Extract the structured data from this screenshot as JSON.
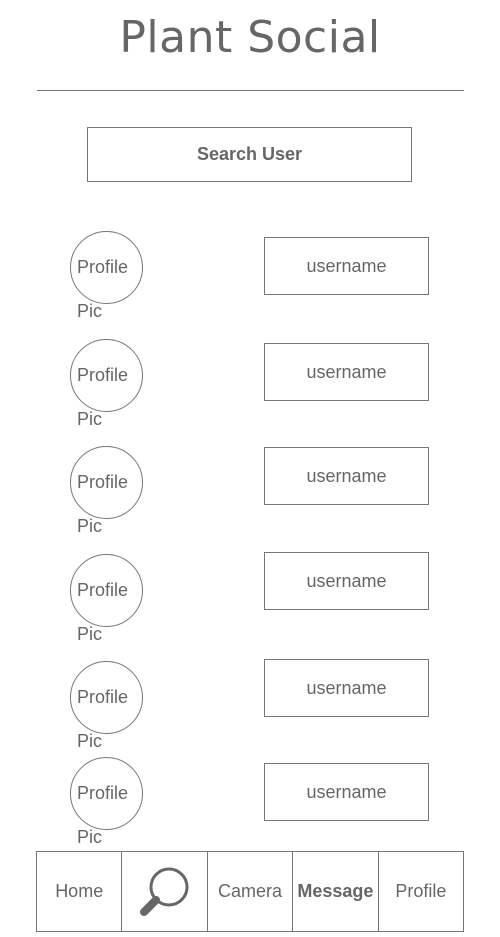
{
  "header": {
    "title": "Plant Social"
  },
  "search": {
    "label": "Search User"
  },
  "users": [
    {
      "pic_line1": "Profile",
      "pic_line2": "Pic",
      "username": "username"
    },
    {
      "pic_line1": "Profile",
      "pic_line2": "Pic",
      "username": "username"
    },
    {
      "pic_line1": "Profile",
      "pic_line2": "Pic",
      "username": "username"
    },
    {
      "pic_line1": "Profile",
      "pic_line2": "Pic",
      "username": "username"
    },
    {
      "pic_line1": "Profile",
      "pic_line2": "Pic",
      "username": "username"
    },
    {
      "pic_line1": "Profile",
      "pic_line2": "Pic",
      "username": "username"
    }
  ],
  "nav": {
    "home": "Home",
    "search_icon": "magnifier-icon",
    "camera": "Camera",
    "message": "Message",
    "profile": "Profile"
  },
  "colors": {
    "line": "#777777",
    "text": "#666666",
    "background": "#ffffff"
  }
}
